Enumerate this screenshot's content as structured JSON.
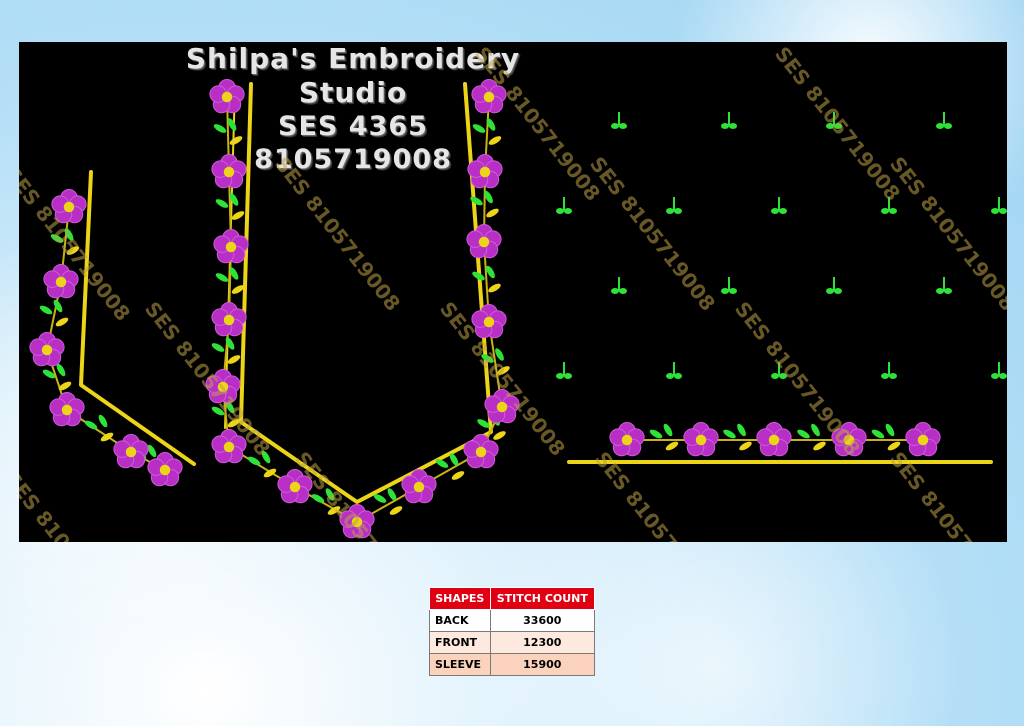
{
  "header": {
    "studio_name": "Shilpa's Embroidery Studio",
    "design_code": "SES 4365",
    "phone": "8105719008"
  },
  "watermark": {
    "text": "SES 8105719008",
    "color": "#b89a40"
  },
  "colors": {
    "background": "#000000",
    "border_gold": "#ecd516",
    "petal_magenta": "#b82fc6",
    "leaf_green": "#2fe23a",
    "table_header_red": "#e00012"
  },
  "table": {
    "headers": [
      "SHAPES",
      "STITCH COUNT"
    ],
    "rows": [
      {
        "shape": "BACK",
        "count": "33600"
      },
      {
        "shape": "FRONT",
        "count": "12300"
      },
      {
        "shape": "SLEEVE",
        "count": "15900"
      }
    ]
  }
}
